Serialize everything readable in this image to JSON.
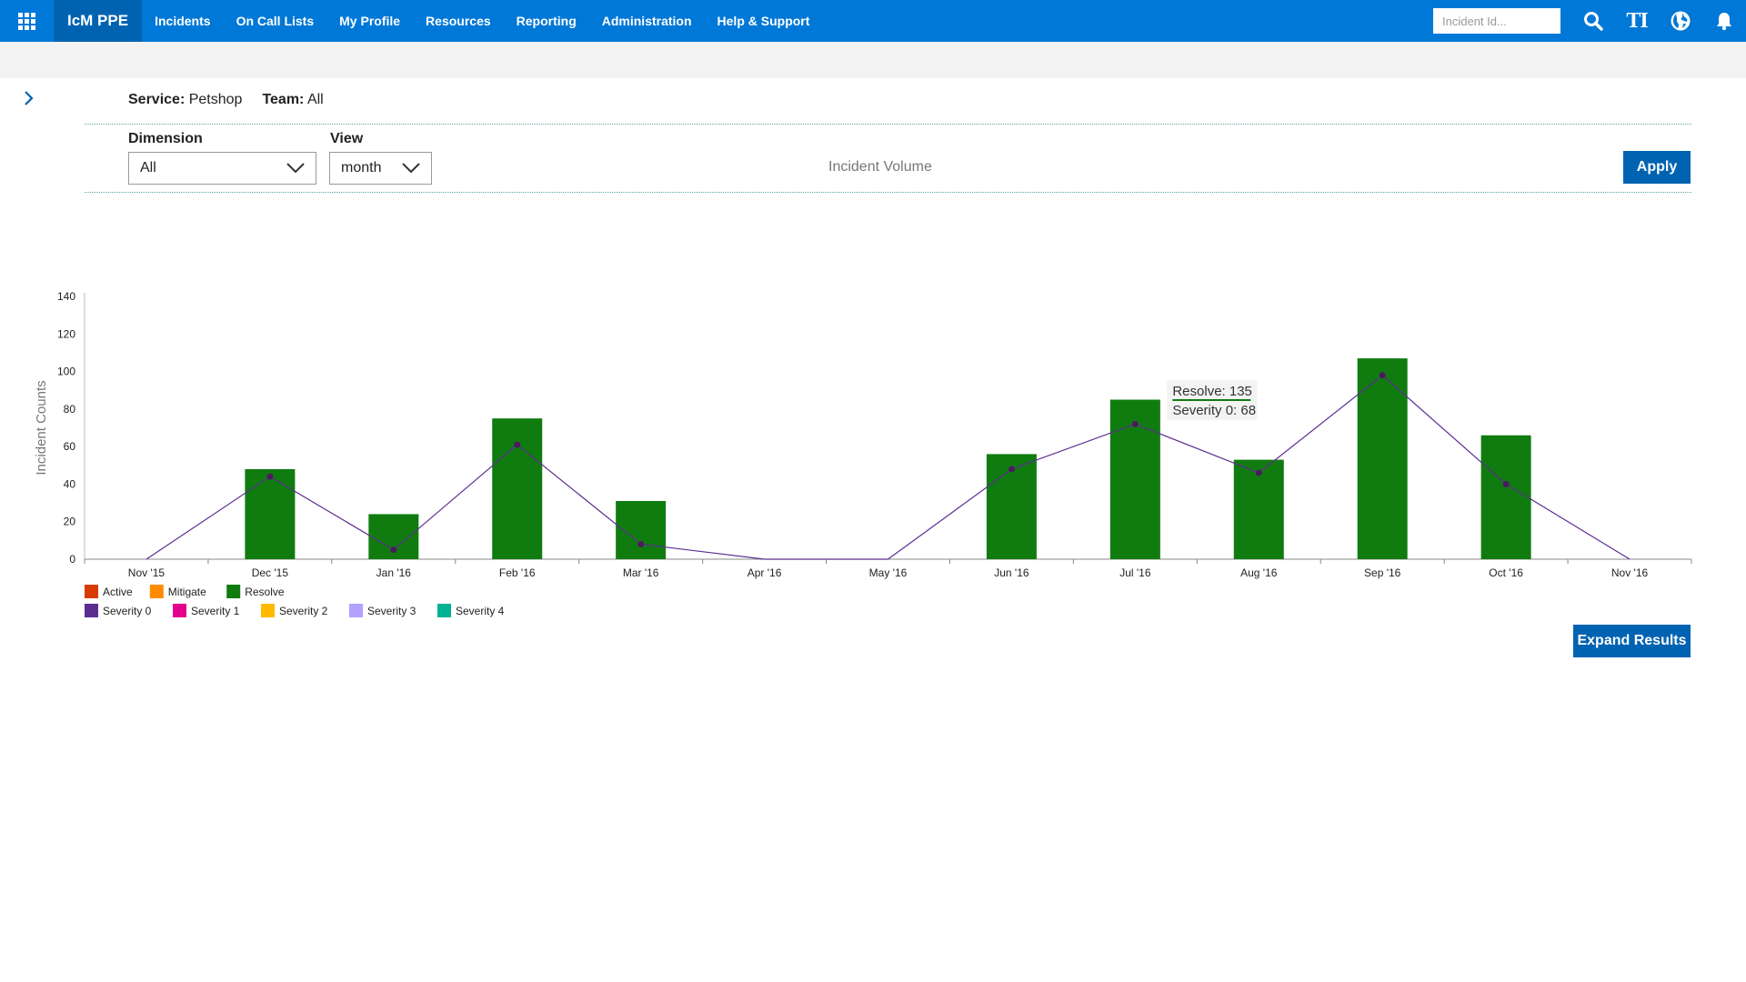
{
  "nav": {
    "brand": "IcM PPE",
    "items": [
      "Incidents",
      "On Call Lists",
      "My Profile",
      "Resources",
      "Reporting",
      "Administration",
      "Help & Support"
    ],
    "search_placeholder": "Incident Id...",
    "icons": [
      "waffle-icon",
      "search-icon",
      "text-size-icon",
      "globe-icon",
      "bell-icon"
    ],
    "ti_label": "TI"
  },
  "filters": {
    "service_label": "Service:",
    "service_value": "Petshop",
    "team_label": "Team:",
    "team_value": "All",
    "dimension_label": "Dimension",
    "dimension_value": "All",
    "view_label": "View",
    "view_value": "month",
    "chart_title": "Incident Volume",
    "apply_label": "Apply",
    "expand_label": "Expand Results"
  },
  "colors": {
    "brand_blue": "#0078d7",
    "dark_blue": "#0063b1",
    "resolve": "#107c10",
    "severity0": "#5c2d91"
  },
  "chart_data": {
    "type": "bar",
    "title": "Incident Volume",
    "xlabel": "",
    "ylabel": "Incident Counts",
    "ylim": [
      0,
      140
    ],
    "yticks": [
      0,
      20,
      40,
      60,
      80,
      100,
      120,
      140
    ],
    "categories": [
      "Nov '15",
      "Dec '15",
      "Jan '16",
      "Feb '16",
      "Mar '16",
      "Apr '16",
      "May '16",
      "Jun '16",
      "Jul '16",
      "Aug '16",
      "Sep '16",
      "Oct '16",
      "Nov '16"
    ],
    "series": [
      {
        "name": "Resolve",
        "type": "bar",
        "color": "#107c10",
        "values": [
          0,
          48,
          24,
          75,
          31,
          0,
          0,
          56,
          85,
          53,
          107,
          66,
          0
        ]
      },
      {
        "name": "Severity 0",
        "type": "line",
        "color": "#5c2d91",
        "values": [
          0,
          44,
          5,
          61,
          8,
          0,
          0,
          48,
          72,
          46,
          98,
          40,
          0
        ]
      }
    ],
    "legend": [
      [
        {
          "name": "Active",
          "color": "#d83b01"
        },
        {
          "name": "Mitigate",
          "color": "#ff8c00"
        },
        {
          "name": "Resolve",
          "color": "#107c10"
        }
      ],
      [
        {
          "name": "Severity 0",
          "color": "#5c2d91"
        },
        {
          "name": "Severity 1",
          "color": "#e3008c"
        },
        {
          "name": "Severity 2",
          "color": "#ffb900"
        },
        {
          "name": "Severity 3",
          "color": "#b4a0ff"
        },
        {
          "name": "Severity 4",
          "color": "#00b294"
        }
      ]
    ],
    "legend_position": "bottom-left",
    "tooltip": {
      "category": "Jul '16",
      "lines": [
        "Resolve: 135",
        "Severity 0: 68"
      ]
    }
  }
}
